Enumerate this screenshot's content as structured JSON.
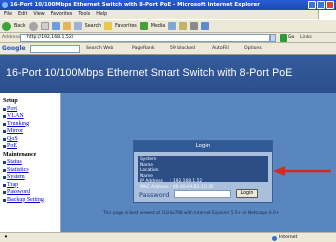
{
  "window": {
    "title": "16-Port 10/100Mbps Ethernet Switch with 8-Port PoE - Microsoft Internet Explorer"
  },
  "menu": [
    "File",
    "Edit",
    "View",
    "Favorites",
    "Tools",
    "Help"
  ],
  "toolbar": {
    "back": "Back",
    "search": "Search",
    "favorites": "Favorites",
    "media": "Media"
  },
  "address": {
    "label": "Address",
    "url": "http://192.168.1.52/",
    "go": "Go",
    "links": "Links"
  },
  "google": {
    "logo": "Google",
    "search_web": "Search Web",
    "pagerank": "PageRank",
    "blocked": "59 blocked",
    "autofill": "AutoFill",
    "options": "Options"
  },
  "page": {
    "title": "16-Port 10/100Mbps Ethernet Smart Switch with 8-Port PoE"
  },
  "sidebar": {
    "setup_heading": "Setup",
    "setup_items": [
      "Port",
      "VLAN",
      "Trunking",
      "Mirror",
      "QoS",
      "PoE"
    ],
    "maintenance_heading": "Maintenance",
    "maintenance_items": [
      "Status",
      "Statistics",
      "System",
      "Trap",
      "Password",
      "Backup Setting"
    ]
  },
  "login": {
    "header": "Login",
    "fields": [
      {
        "key": "System Name",
        "value": ""
      },
      {
        "key": "Location Name",
        "value": ""
      },
      {
        "key": "IP Address",
        "value": ": 192.168.1.52"
      },
      {
        "key": "MAC Address",
        "value": ": 00-40-FA-B2-1C-2F"
      }
    ],
    "password_label": "Password",
    "button": "Login"
  },
  "footnote": "This page is best viewed at 1024x768 with Internet Explorer 5.5+ or Netscape 6.0+",
  "status": {
    "zone": "Internet"
  },
  "colors": {
    "header_bg": "#345b9c",
    "main_bg": "#5a86c0",
    "arrow": "#d42a20"
  }
}
